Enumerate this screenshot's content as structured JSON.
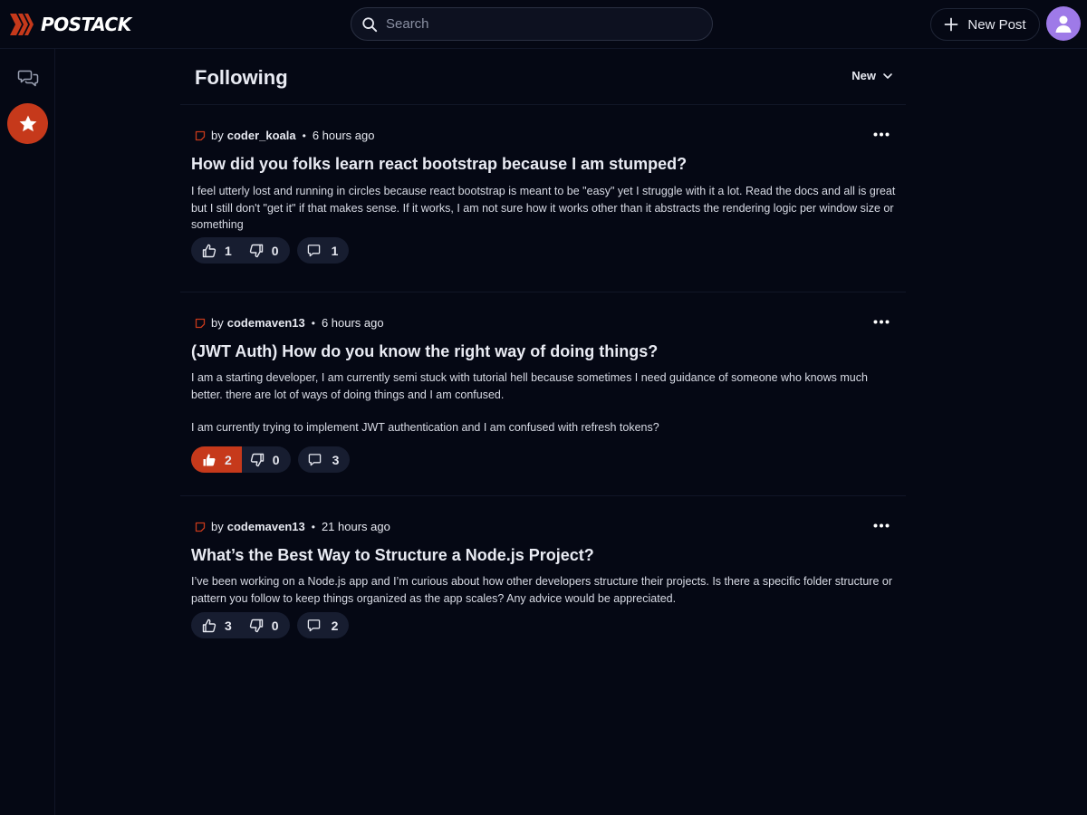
{
  "app": {
    "name": "POSTACK",
    "brand_color": "#c6391b"
  },
  "header": {
    "search_placeholder": "Search",
    "new_post_label": "New Post"
  },
  "sidebar": {
    "items": [
      {
        "name": "chat",
        "icon": "chat-bubbles-icon",
        "active": false
      },
      {
        "name": "following",
        "icon": "star-icon",
        "active": true
      }
    ]
  },
  "feed": {
    "title": "Following",
    "sort_label": "New",
    "posts": [
      {
        "by": "by",
        "author": "coder_koala",
        "time": "6 hours ago",
        "title": "How did you folks learn react bootstrap because I am stumped?",
        "body": [
          "I feel utterly lost and running in circles because react bootstrap is meant to be \"easy\" yet I struggle with it a lot. Read the docs and all is great but I still don't \"get it\" if that makes sense. If it works, I am not sure how it works other than it abstracts the rendering logic per window size or something"
        ],
        "upvotes": "1",
        "downvotes": "0",
        "comments": "1",
        "upvoted": false
      },
      {
        "by": "by",
        "author": "codemaven13",
        "time": "6 hours ago",
        "title": "(JWT Auth) How do you know the right way of doing things?",
        "body": [
          "I am a starting developer, I am currently semi stuck with tutorial hell because sometimes I need guidance of someone who knows much better. there are lot of ways of doing things and I am confused.",
          "I am currently trying to implement JWT authentication and I am confused with refresh tokens?"
        ],
        "upvotes": "2",
        "downvotes": "0",
        "comments": "3",
        "upvoted": true
      },
      {
        "by": "by",
        "author": "codemaven13",
        "time": "21 hours ago",
        "title": "What’s the Best Way to Structure a Node.js Project?",
        "body": [
          "I’ve been working on a Node.js app and I’m curious about how other developers structure their projects. Is there a specific folder structure or pattern you follow to keep things organized as the app scales? Any advice would be appreciated."
        ],
        "upvotes": "3",
        "downvotes": "0",
        "comments": "2",
        "upvoted": false
      }
    ]
  }
}
